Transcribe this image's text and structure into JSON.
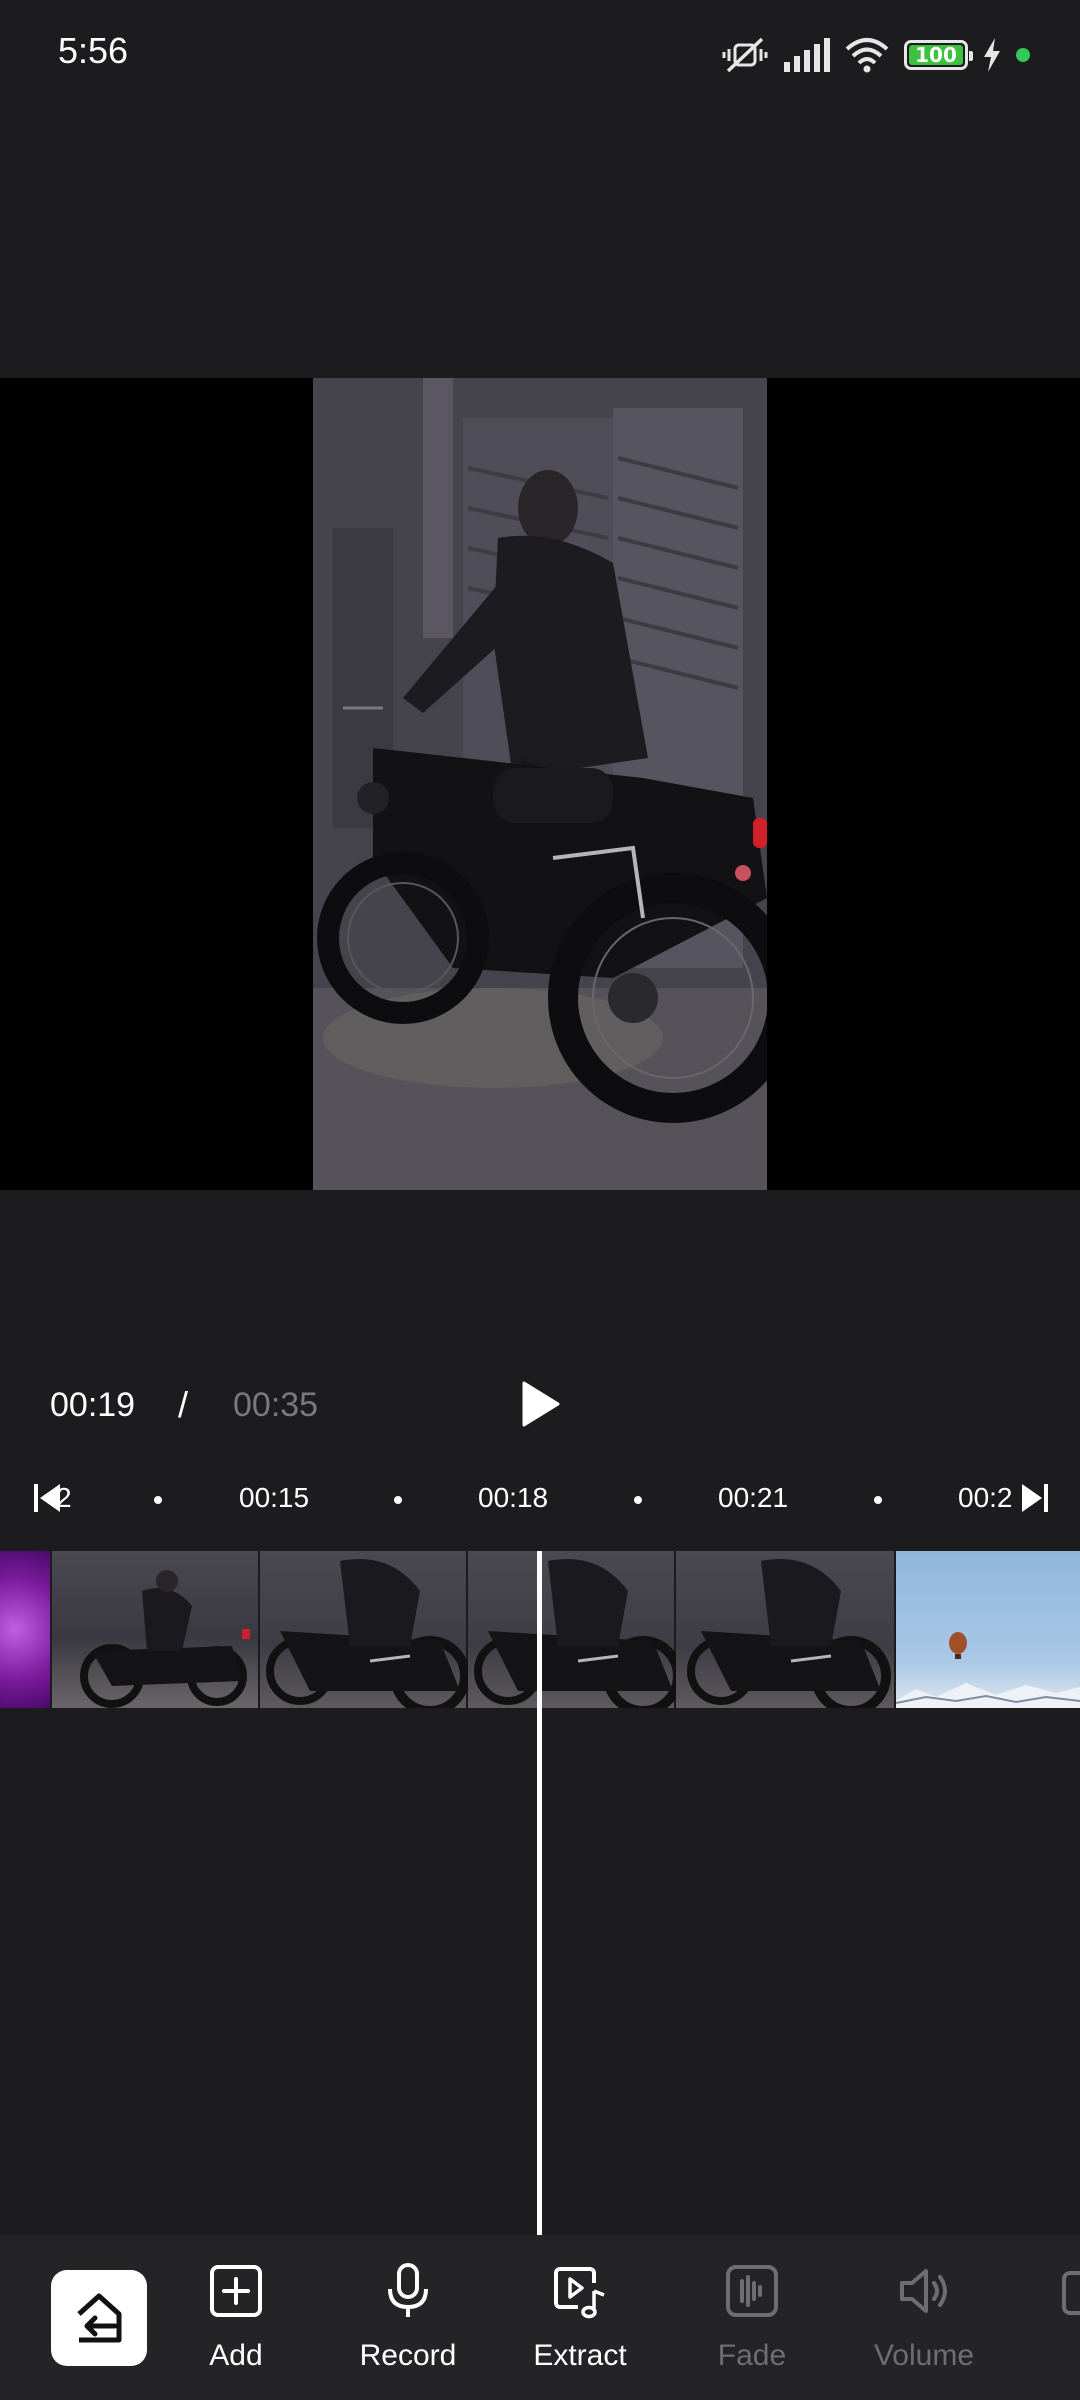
{
  "status_bar": {
    "time": "5:56",
    "battery": "100",
    "icons": [
      "mute-vibrate-icon",
      "cellular-signal-icon",
      "wifi-icon",
      "battery-icon",
      "charging-bolt-icon",
      "privacy-indicator-dot"
    ]
  },
  "preview": {
    "description_icon": "video-preview"
  },
  "playback": {
    "current_time": "00:19",
    "separator": "/",
    "total_time": "00:35"
  },
  "timeline": {
    "ruler_labels": [
      "2",
      "00:15",
      "00:18",
      "00:21",
      "00:2"
    ]
  },
  "toolbar": {
    "items": [
      {
        "label": "Add",
        "icon": "add-icon",
        "enabled": true
      },
      {
        "label": "Record",
        "icon": "microphone-icon",
        "enabled": true
      },
      {
        "label": "Extract",
        "icon": "extract-audio-icon",
        "enabled": true
      },
      {
        "label": "Fade",
        "icon": "fade-icon",
        "enabled": false
      },
      {
        "label": "Volume",
        "icon": "volume-icon",
        "enabled": false
      }
    ]
  },
  "colors": {
    "background": "#1c1c1e",
    "toolbar": "#242426",
    "muted_text": "#7a7a7c",
    "disabled_text": "#6e6e70",
    "battery_green": "#3ec13e"
  }
}
